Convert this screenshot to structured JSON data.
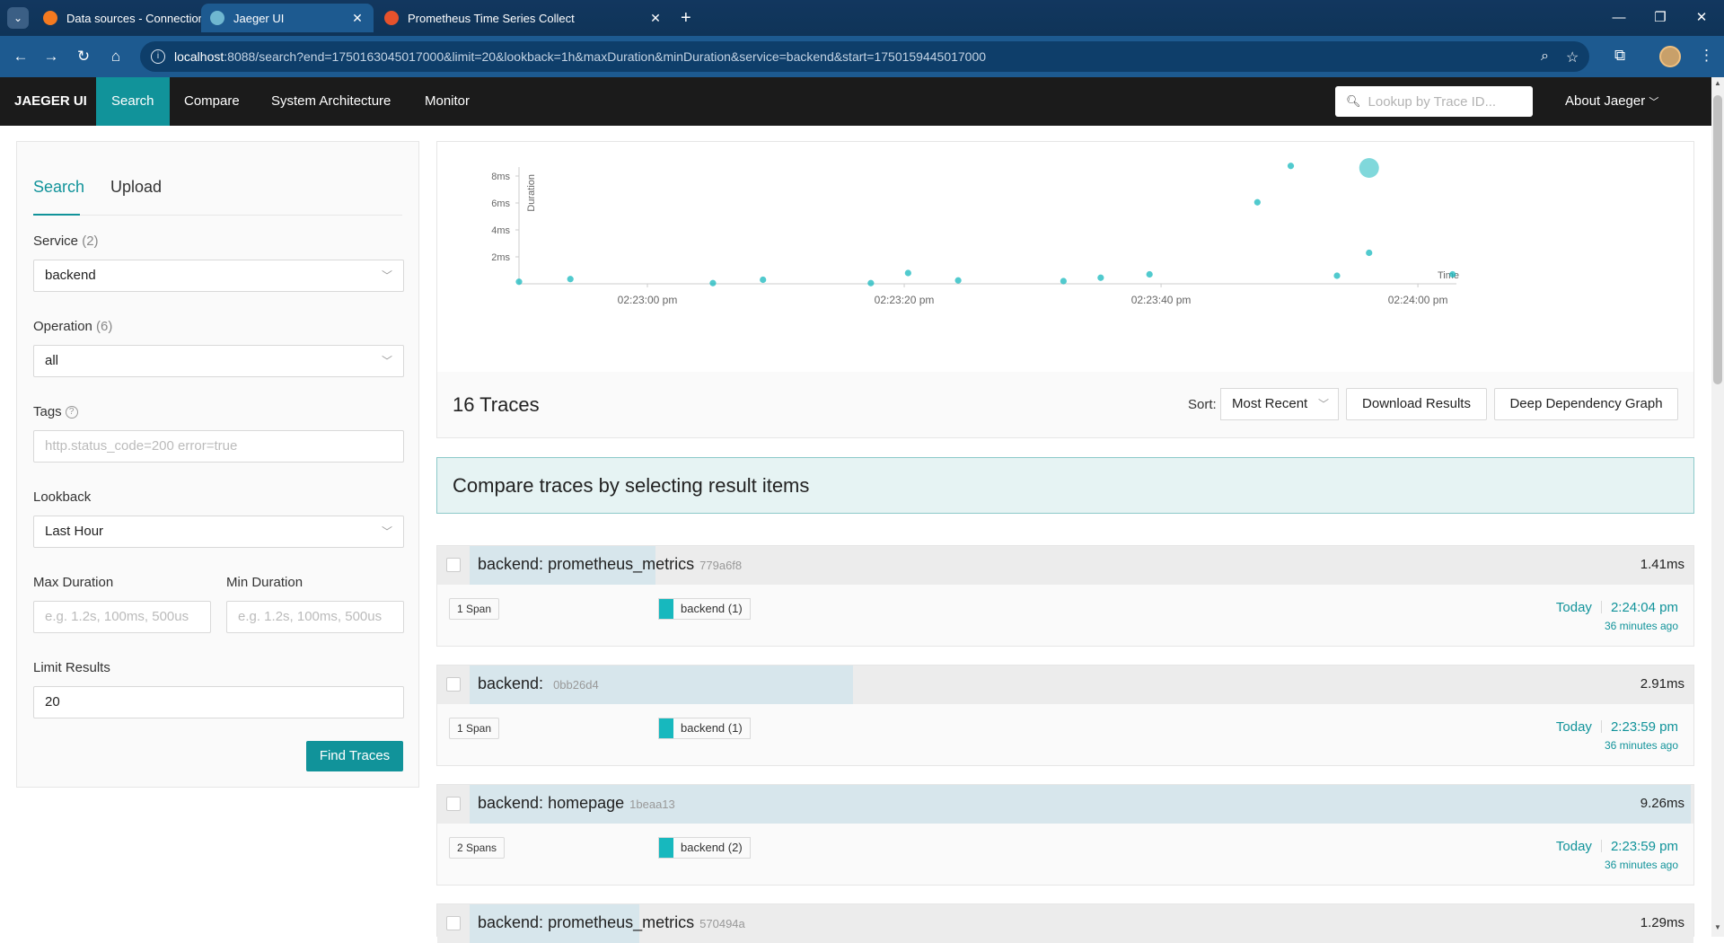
{
  "browser": {
    "tabs": [
      {
        "title": "Data sources - Connections - G",
        "favicon_color": "#f47a20"
      },
      {
        "title": "Jaeger UI",
        "favicon_color": "#6fb7d0"
      },
      {
        "title": "Prometheus Time Series Collect",
        "favicon_color": "#e6522c"
      }
    ],
    "url_host": "localhost",
    "url_rest": ":8088/search?end=1750163045017000&limit=20&lookback=1h&maxDuration&minDuration&service=backend&start=1750159445017000"
  },
  "nav": {
    "brand": "JAEGER UI",
    "items": [
      "Search",
      "Compare",
      "System Architecture",
      "Monitor"
    ],
    "lookup_placeholder": "Lookup by Trace ID...",
    "about": "About Jaeger"
  },
  "search": {
    "tab_search": "Search",
    "tab_upload": "Upload",
    "service_label": "Service",
    "service_count": "(2)",
    "service_value": "backend",
    "operation_label": "Operation",
    "operation_count": "(6)",
    "operation_value": "all",
    "tags_label": "Tags",
    "tags_placeholder": "http.status_code=200 error=true",
    "lookback_label": "Lookback",
    "lookback_value": "Last Hour",
    "max_duration_label": "Max Duration",
    "max_duration_placeholder": "e.g. 1.2s, 100ms, 500us",
    "min_duration_label": "Min Duration",
    "min_duration_placeholder": "e.g. 1.2s, 100ms, 500us",
    "limit_label": "Limit Results",
    "limit_value": "20",
    "find_button": "Find Traces"
  },
  "chart_data": {
    "type": "scatter",
    "ylabel": "Duration",
    "xlabel": "Time",
    "y_ticks": [
      "2ms",
      "4ms",
      "6ms",
      "8ms"
    ],
    "x_ticks": [
      "02:23:00 pm",
      "02:23:20 pm",
      "02:23:40 pm",
      "02:24:00 pm"
    ],
    "ylim": [
      0,
      10
    ],
    "x_unit": "seconds after 02:22:50 pm",
    "xlim": [
      0,
      73
    ],
    "points": [
      {
        "x": 0.0,
        "y": 0.15,
        "size": 1
      },
      {
        "x": 4.0,
        "y": 0.35,
        "size": 1
      },
      {
        "x": 15.1,
        "y": 0.05,
        "size": 1
      },
      {
        "x": 19.0,
        "y": 0.3,
        "size": 1
      },
      {
        "x": 27.4,
        "y": 0.05,
        "size": 1
      },
      {
        "x": 30.3,
        "y": 0.8,
        "size": 1
      },
      {
        "x": 34.2,
        "y": 0.25,
        "size": 1
      },
      {
        "x": 42.4,
        "y": 0.2,
        "size": 1
      },
      {
        "x": 45.3,
        "y": 0.45,
        "size": 1
      },
      {
        "x": 49.1,
        "y": 0.7,
        "size": 1
      },
      {
        "x": 57.5,
        "y": 6.05,
        "size": 1
      },
      {
        "x": 60.1,
        "y": 8.75,
        "size": 1
      },
      {
        "x": 63.7,
        "y": 0.6,
        "size": 1
      },
      {
        "x": 66.2,
        "y": 2.3,
        "size": 1
      },
      {
        "x": 66.2,
        "y": 8.6,
        "size": 3
      },
      {
        "x": 72.7,
        "y": 0.7,
        "size": 1
      }
    ]
  },
  "results": {
    "count": "16 Traces",
    "sort_label": "Sort:",
    "sort_value": "Most Recent",
    "download": "Download Results",
    "ddg": "Deep Dependency Graph",
    "compare_text": "Compare traces by selecting result items"
  },
  "traces": [
    {
      "service": "backend:",
      "op": "prometheus_metrics",
      "id": "779a6f8",
      "duration": "1.41ms",
      "duration_ms": 1.41,
      "spans": "1 Span",
      "svc": "backend (1)",
      "day": "Today",
      "time": "2:24:04 pm",
      "ago": "36 minutes ago"
    },
    {
      "service": "backend:",
      "op": "",
      "id": "0bb26d4",
      "duration": "2.91ms",
      "duration_ms": 2.91,
      "spans": "1 Span",
      "svc": "backend (1)",
      "day": "Today",
      "time": "2:23:59 pm",
      "ago": "36 minutes ago"
    },
    {
      "service": "backend:",
      "op": "homepage",
      "id": "1beaa13",
      "duration": "9.26ms",
      "duration_ms": 9.26,
      "spans": "2 Spans",
      "svc": "backend (2)",
      "day": "Today",
      "time": "2:23:59 pm",
      "ago": "36 minutes ago"
    },
    {
      "service": "backend:",
      "op": "prometheus_metrics",
      "id": "570494a",
      "duration": "1.29ms",
      "duration_ms": 1.29,
      "spans": "",
      "svc": "",
      "day": "",
      "time": "",
      "ago": ""
    }
  ],
  "colors": {
    "accent": "#11939a",
    "service": "#17b8be",
    "chrome": "#1d5a90"
  }
}
